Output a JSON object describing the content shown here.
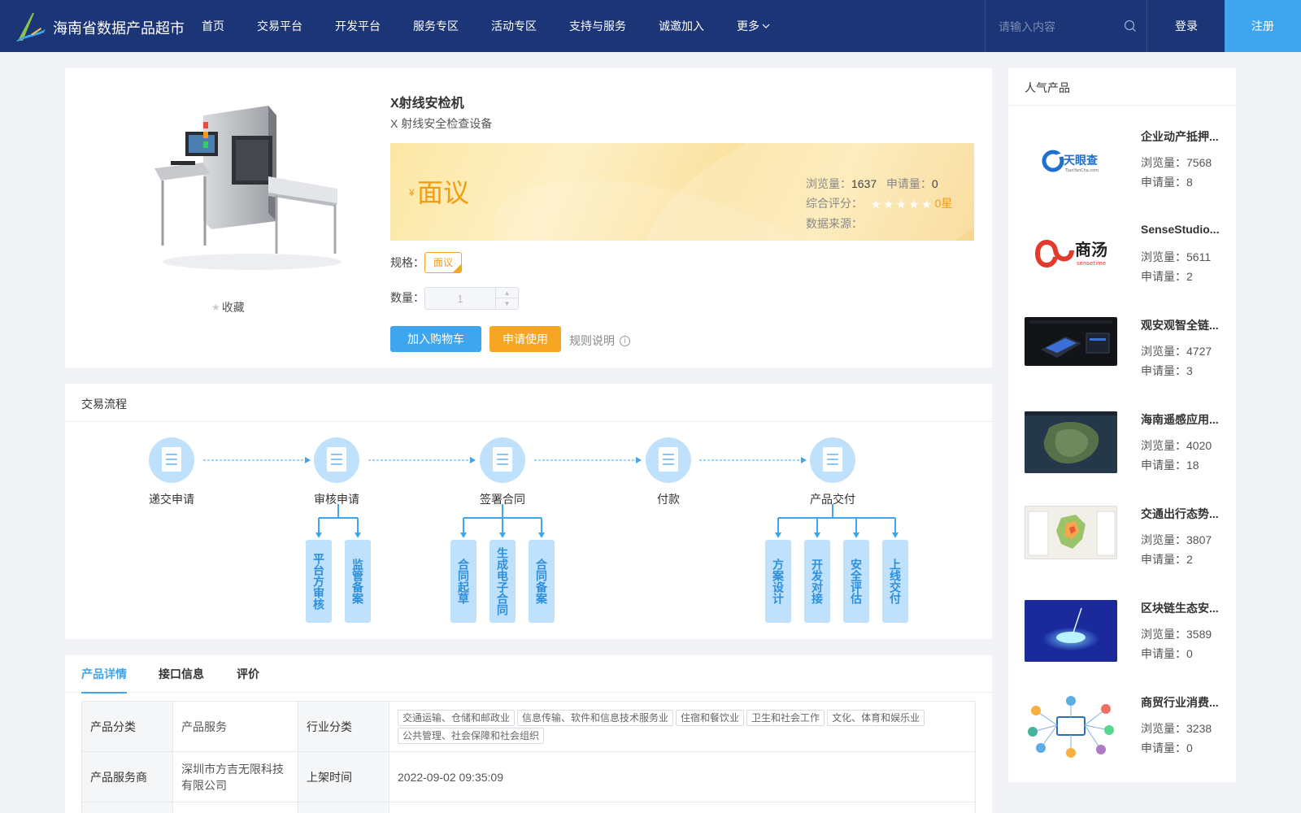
{
  "header": {
    "site_title": "海南省数据产品超市",
    "nav": [
      "首页",
      "交易平台",
      "开发平台",
      "服务专区",
      "活动专区",
      "支持与服务",
      "诚邀加入"
    ],
    "more_label": "更多",
    "search_placeholder": "请输入内容",
    "login_label": "登录",
    "register_label": "注册",
    "colors": {
      "bar": "#1c3577",
      "register": "#3fa5ee"
    }
  },
  "product": {
    "title": "X射线安检机",
    "subtitle": "X 射线安全检查设备",
    "favorite_label": "收藏",
    "currency_symbol": "¥",
    "price_text": "面议",
    "views_label": "浏览量：",
    "views": "1637",
    "applications_label": "申请量：",
    "applications": "0",
    "rating_label": "综合评分：",
    "rating_text": "0星",
    "rating_value": 0,
    "source_label": "数据来源：",
    "spec_label": "规格：",
    "spec_value": "面议",
    "qty_label": "数量：",
    "qty_value": "1",
    "add_cart_label": "加入购物车",
    "apply_label": "申请使用",
    "rules_label": "规则说明"
  },
  "flow": {
    "title": "交易流程",
    "steps": [
      "递交申请",
      "审核申请",
      "签署合同",
      "付款",
      "产品交付"
    ],
    "sub_audit": [
      "平台方审核",
      "监管备案"
    ],
    "sub_contract": [
      "合同起草",
      "生成电子合同",
      "合同备案"
    ],
    "sub_delivery": [
      "方案设计",
      "开发对接",
      "安全评估",
      "上线交付"
    ]
  },
  "details": {
    "tabs": [
      "产品详情",
      "接口信息",
      "评价"
    ],
    "active_tab": "产品详情",
    "row1": {
      "k1": "产品分类",
      "v1": "产品服务",
      "k2": "行业分类",
      "tags": [
        "交通运输、仓储和邮政业",
        "信息传输、软件和信息技术服务业",
        "住宿和餐饮业",
        "卫生和社会工作",
        "文化、体育和娱乐业",
        "公共管理、社会保障和社会组织"
      ]
    },
    "row2": {
      "k1": "产品服务商",
      "v1": "深圳市方吉无限科技有限公司",
      "k2": "上架时间",
      "v2": "2022-09-02 09:35:09"
    }
  },
  "popular": {
    "title": "人气产品",
    "views_label": "浏览量：",
    "applications_label": "申请量：",
    "items": [
      {
        "name": "企业动产抵押...",
        "views": "7568",
        "applications": "8",
        "thumb": "tianyancha-logo",
        "logo_text": "天眼查",
        "logo_sub": "TianYanCha.com"
      },
      {
        "name": "SenseStudio...",
        "views": "5611",
        "applications": "2",
        "thumb": "sensetime-logo",
        "logo_text": "商汤",
        "logo_sub": "sensetime"
      },
      {
        "name": "观安观智全链...",
        "views": "4727",
        "applications": "3",
        "thumb": "dark-dashboard-image"
      },
      {
        "name": "海南遥感应用...",
        "views": "4020",
        "applications": "18",
        "thumb": "satellite-map-image"
      },
      {
        "name": "交通出行态势...",
        "views": "3807",
        "applications": "2",
        "thumb": "traffic-map-image"
      },
      {
        "name": "区块链生态安...",
        "views": "3589",
        "applications": "0",
        "thumb": "blockchain-image"
      },
      {
        "name": "商贸行业消费...",
        "views": "3238",
        "applications": "0",
        "thumb": "network-diagram-image"
      }
    ]
  }
}
